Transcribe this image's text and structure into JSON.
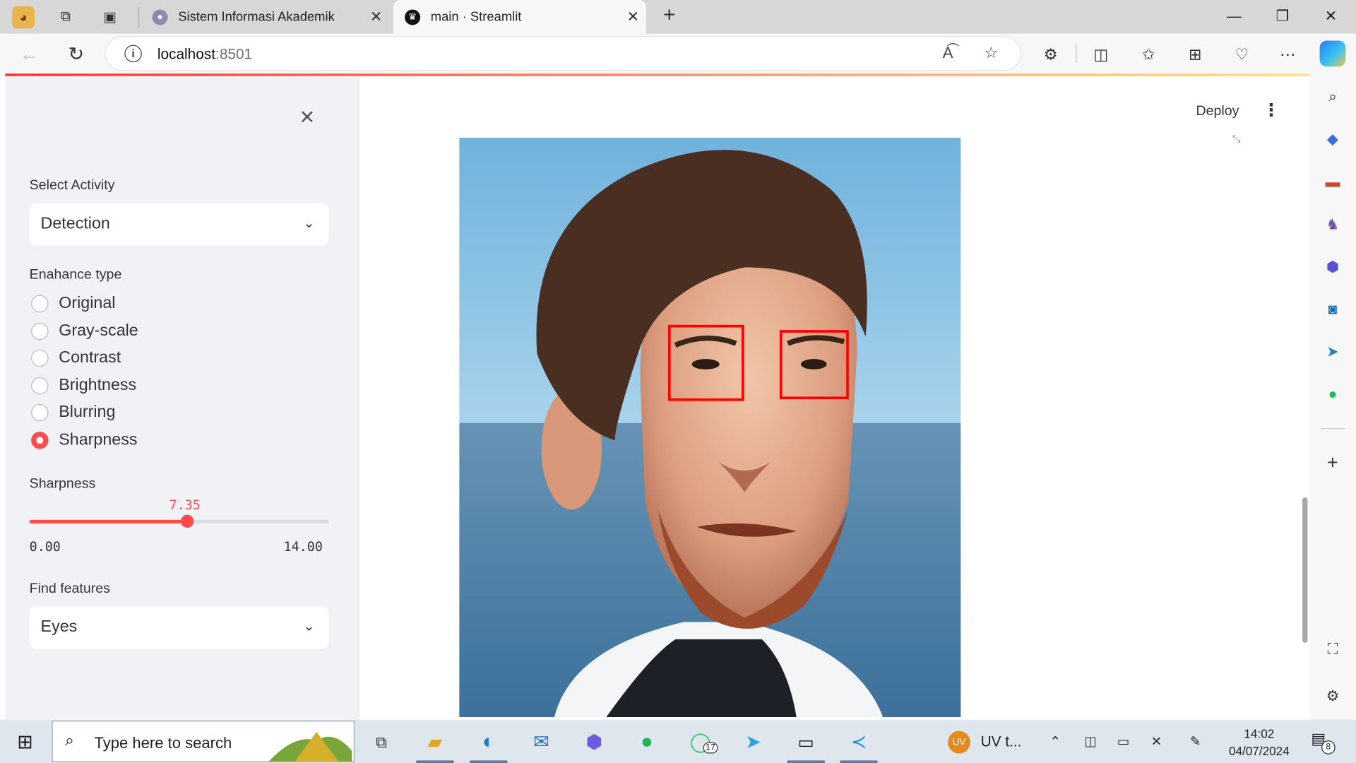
{
  "browser": {
    "tabs": [
      {
        "title": "Sistem Informasi Akademik"
      },
      {
        "title": "main · Streamlit"
      }
    ],
    "address": {
      "host": "localhost",
      "port": ":8501"
    }
  },
  "app": {
    "header": {
      "deploy_label": "Deploy"
    },
    "sidebar": {
      "activity_label": "Select Activity",
      "activity_value": "Detection",
      "enhance_label": "Enahance type",
      "enhance_options": [
        "Original",
        "Gray-scale",
        "Contrast",
        "Brightness",
        "Blurring",
        "Sharpness"
      ],
      "enhance_selected": "Sharpness",
      "slider": {
        "label": "Sharpness",
        "value": "7.35",
        "min": "0.00",
        "max": "14.00",
        "fraction": 0.525
      },
      "features_label": "Find features",
      "features_value": "Eyes"
    },
    "image": {
      "detections": 2,
      "box_color": "#ff0000"
    }
  },
  "taskbar": {
    "search_placeholder": "Type here to search",
    "whatsapp_badge": "17",
    "user_initials": "UV",
    "user_label": "UV t...",
    "time": "14:02",
    "date": "04/07/2024",
    "notification_count": "8"
  },
  "colors": {
    "accent": "#ff4b4b",
    "sidebar_bg": "#f0f2f6",
    "tabbar_bg": "#d7d7d7"
  }
}
